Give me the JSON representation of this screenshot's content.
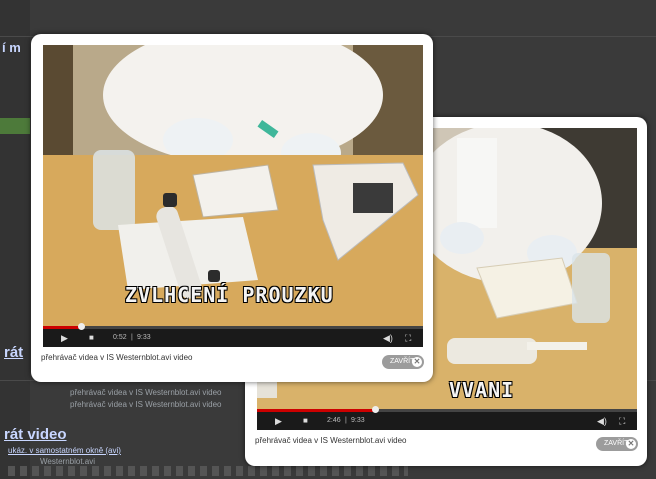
{
  "background_page": {
    "fragment_top": "í m",
    "fragment_mid": "rát",
    "fragment_line1": "přehrávač videa v IS Westernblot.avi video",
    "fragment_line2": "přehrávač videa v IS Westernblot.avi video",
    "heading": "rát video",
    "link": "ukáz. v samostatném okně (avi)",
    "file": "Westernblot.avi"
  },
  "popup1": {
    "subtitle": "ZVLHCENÍ PROUZKU",
    "time_elapsed": "0:52",
    "time_total": "9:33",
    "progress": 0.1,
    "caption": "přehrávač videa v IS Westernblot.avi video",
    "close_label": "ZAVŘÍT"
  },
  "popup2": {
    "subtitle": "VVANI",
    "time_elapsed": "2:46",
    "time_total": "9:33",
    "progress": 0.31,
    "caption": "přehrávač videa v IS Westernblot.avi video",
    "close_label": "ZAVŘÍT"
  },
  "icons": {
    "play": "play-icon",
    "stop": "stop-icon",
    "volume": "volume-icon",
    "fullscreen": "fullscreen-icon",
    "close": "close-icon"
  }
}
